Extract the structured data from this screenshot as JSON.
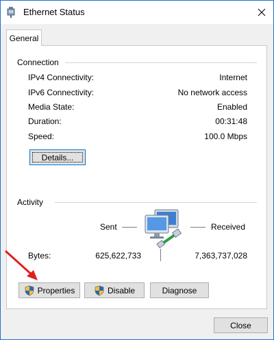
{
  "window": {
    "title": "Ethernet Status",
    "title_icon": "network-adapter-icon",
    "close_icon": "close-icon"
  },
  "tabs": [
    {
      "label": "General",
      "selected": true
    }
  ],
  "connection": {
    "group_label": "Connection",
    "rows": [
      {
        "label": "IPv4 Connectivity:",
        "value": "Internet"
      },
      {
        "label": "IPv6 Connectivity:",
        "value": "No network access"
      },
      {
        "label": "Media State:",
        "value": "Enabled"
      },
      {
        "label": "Duration:",
        "value": "00:31:48"
      },
      {
        "label": "Speed:",
        "value": "100.0 Mbps"
      }
    ],
    "details_button": "Details..."
  },
  "activity": {
    "group_label": "Activity",
    "sent_label": "Sent",
    "received_label": "Received",
    "bytes_label": "Bytes:",
    "bytes_sent": "625,622,733",
    "bytes_received": "7,363,737,028",
    "icon": "network-computers-icon"
  },
  "buttons": {
    "properties": "Properties",
    "disable": "Disable",
    "diagnose": "Diagnose",
    "close": "Close"
  },
  "colors": {
    "accent": "#0078d7",
    "annotation_arrow": "#e02020"
  }
}
